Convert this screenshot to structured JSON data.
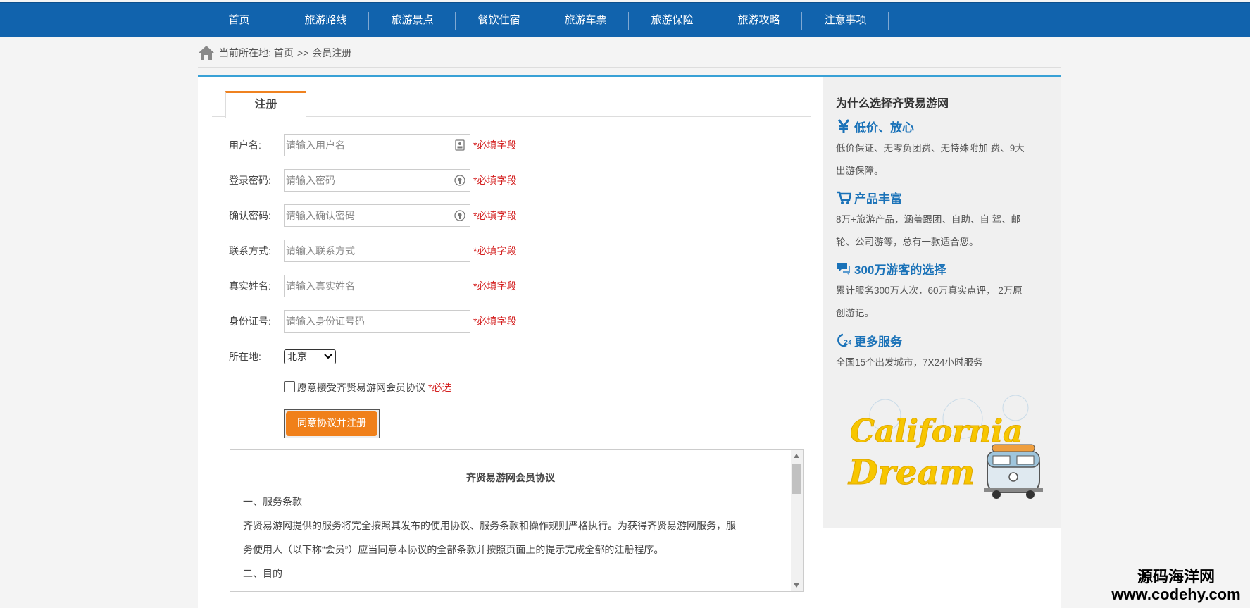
{
  "nav": {
    "items": [
      {
        "label": "首页"
      },
      {
        "label": "旅游路线"
      },
      {
        "label": "旅游景点"
      },
      {
        "label": "餐饮住宿"
      },
      {
        "label": "旅游车票"
      },
      {
        "label": "旅游保险"
      },
      {
        "label": "旅游攻略"
      },
      {
        "label": "注意事项"
      }
    ]
  },
  "breadcrumb": {
    "prefix": "当前所在地:",
    "home": "首页",
    "sep": ">>",
    "current": "会员注册"
  },
  "form": {
    "tab": "注册",
    "fields": [
      {
        "label": "用户名:",
        "placeholder": "请输入用户名",
        "required": "*必填字段",
        "icon": "id-card-icon"
      },
      {
        "label": "登录密码:",
        "placeholder": "请输入密码",
        "required": "*必填字段",
        "icon": "lock-icon"
      },
      {
        "label": "确认密码:",
        "placeholder": "请输入确认密码",
        "required": "*必填字段",
        "icon": "lock-icon"
      },
      {
        "label": "联系方式:",
        "placeholder": "请输入联系方式",
        "required": "*必填字段"
      },
      {
        "label": "真实姓名:",
        "placeholder": "请输入真实姓名",
        "required": "*必填字段"
      },
      {
        "label": "身份证号:",
        "placeholder": "请输入身份证号码",
        "required": "*必填字段"
      }
    ],
    "city_label": "所在地:",
    "city_value": "北京",
    "agree_text": "愿意接受齐贤易游网会员协议",
    "agree_required": "*必选",
    "submit": "同意协议并注册"
  },
  "terms": {
    "title": "齐贤易游网会员协议",
    "lines": [
      "一、服务条款",
      "齐贤易游网提供的服务将完全按照其发布的使用协议、服务条款和操作规则严格执行。为获得齐贤易游网服务，服",
      "务使用人（以下称“会员”）应当同意本协议的全部条款并按照页面上的提示完成全部的注册程序。",
      "二、目的"
    ]
  },
  "sidebar": {
    "title": "为什么选择齐贤易游网",
    "sections": [
      {
        "icon": "yen-icon",
        "heading": "低价、放心",
        "lines": [
          "低价保证、无零负团费、无特殊附加 费、9大",
          "出游保障。"
        ]
      },
      {
        "icon": "cart-icon",
        "heading": "产品丰富",
        "lines": [
          "8万+旅游产品，涵盖跟团、自助、自 驾、邮",
          "轮、公司游等，总有一款适合您。"
        ]
      },
      {
        "icon": "chat-icon",
        "heading": "300万游客的选择",
        "lines": [
          "累计服务300万人次，60万真实点评， 2万原",
          "创游记。"
        ]
      },
      {
        "icon": "clock-24-icon",
        "heading": "更多服务",
        "lines": [
          "全国15个出发城市，7X24小时服务"
        ]
      }
    ],
    "banner_text_1": "California",
    "banner_text_2": "Dream"
  },
  "watermark": {
    "line1": "源码海洋网",
    "line2": "www.codehy.com"
  },
  "colors": {
    "nav_bg": "#1163ad",
    "accent_orange": "#f0801a",
    "required_red": "#d42020",
    "heading_blue": "#1a72b8"
  }
}
